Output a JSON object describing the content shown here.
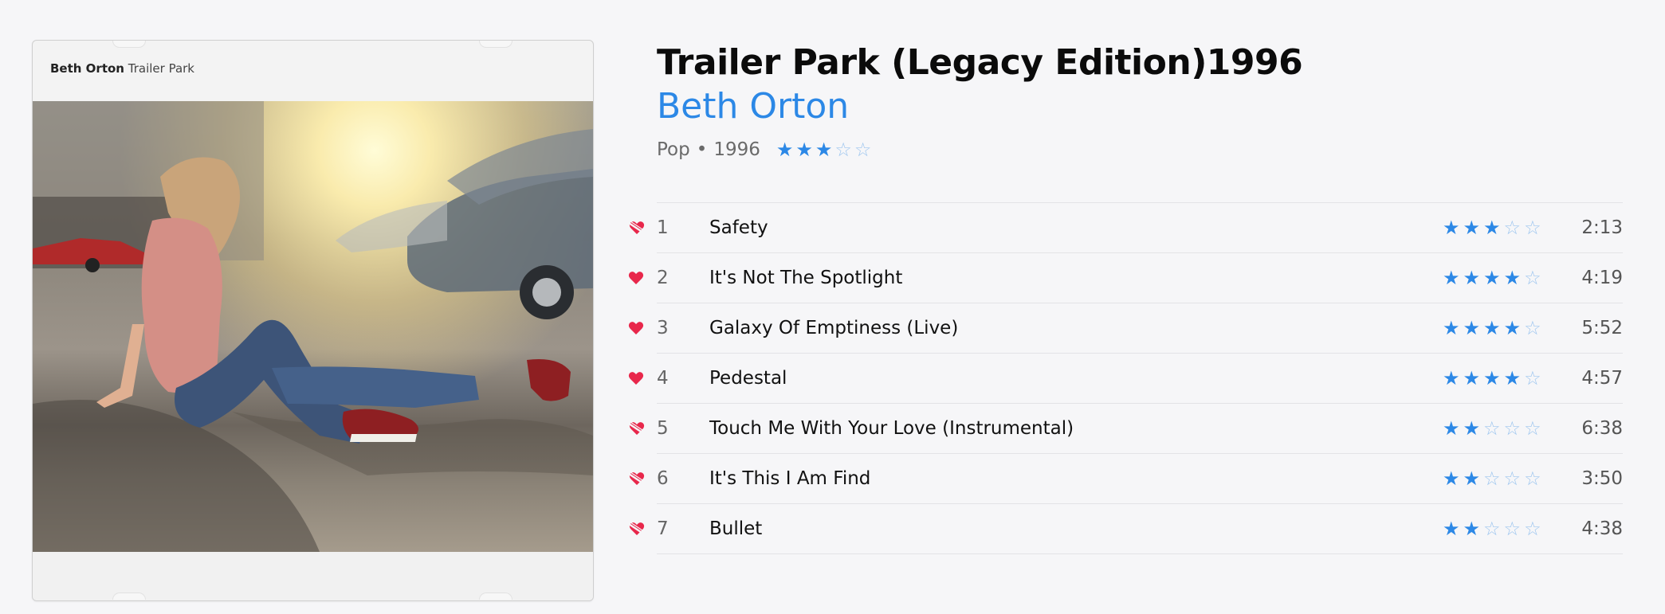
{
  "album": {
    "title": "Trailer Park (Legacy Edition)1996",
    "artist": "Beth Orton",
    "genre": "Pop",
    "separator": "•",
    "year": "1996",
    "rating": 3,
    "cover_text": {
      "artist": "Beth Orton",
      "title": "Trailer Park"
    }
  },
  "colors": {
    "accent": "#2c88e6",
    "heart": "#e8274b",
    "star_empty": "#9ec6ef"
  },
  "tracks": [
    {
      "number": "1",
      "title": "Safety",
      "rating": 3,
      "duration": "2:13",
      "heart": "disliked-heart-icon"
    },
    {
      "number": "2",
      "title": "It's Not The Spotlight",
      "rating": 4,
      "duration": "4:19",
      "heart": "heart-icon"
    },
    {
      "number": "3",
      "title": "Galaxy Of Emptiness (Live)",
      "rating": 4,
      "duration": "5:52",
      "heart": "heart-icon"
    },
    {
      "number": "4",
      "title": "Pedestal",
      "rating": 4,
      "duration": "4:57",
      "heart": "heart-icon"
    },
    {
      "number": "5",
      "title": "Touch Me With Your Love (Instrumental)",
      "rating": 2,
      "duration": "6:38",
      "heart": "disliked-heart-icon"
    },
    {
      "number": "6",
      "title": "It's This I Am Find",
      "rating": 2,
      "duration": "3:50",
      "heart": "disliked-heart-icon"
    },
    {
      "number": "7",
      "title": "Bullet",
      "rating": 2,
      "duration": "4:38",
      "heart": "disliked-heart-icon"
    }
  ]
}
